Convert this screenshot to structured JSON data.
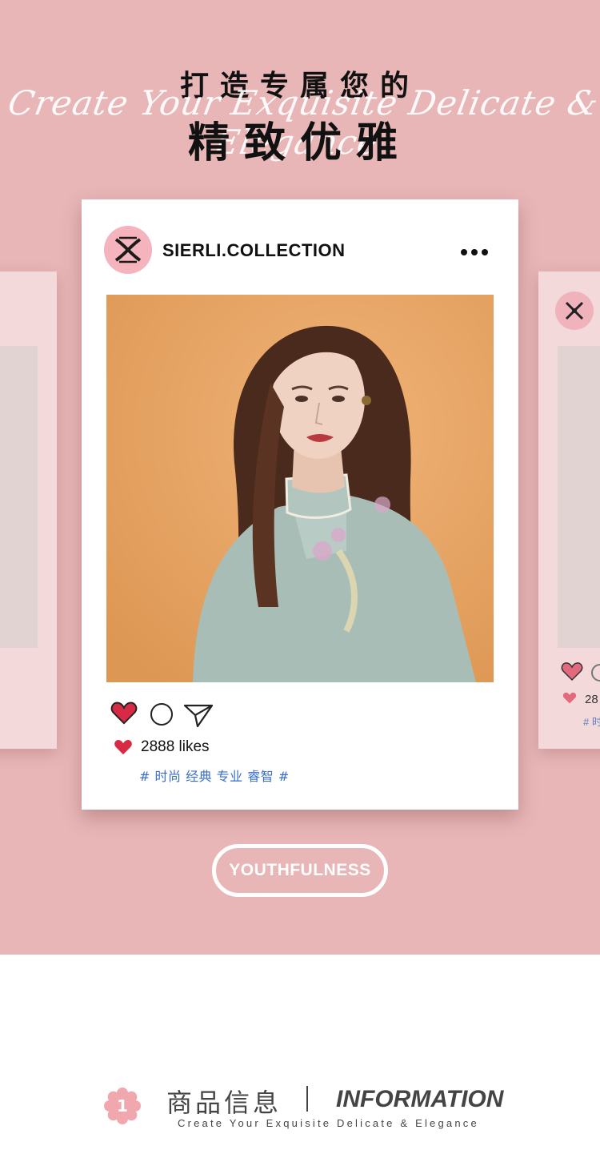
{
  "hero": {
    "title_cn_top": "打造专属您的",
    "title_script": "Create Your Exquisite Delicate & Elegance",
    "title_cn_main": "精致优雅",
    "background_color": "#e8b6b7"
  },
  "post": {
    "account_name": "SIERLI.COLLECTION",
    "more_icon": "more-dots-icon",
    "likes_text": "2888 likes",
    "tags": "# 时尚 经典 专业 睿智 #",
    "like_color": "#d62a45",
    "tag_color": "#3a6fc9"
  },
  "side_right": {
    "likes_text": "28",
    "tags": "# 时"
  },
  "badge_button": {
    "label": "YOUTHFULNESS"
  },
  "info": {
    "badge_number": "1",
    "title_cn": "商品信息",
    "title_en": "INFORMATION",
    "subtitle": "Create Your Exquisite Delicate & Elegance",
    "accent_color": "#f0a7ae"
  }
}
